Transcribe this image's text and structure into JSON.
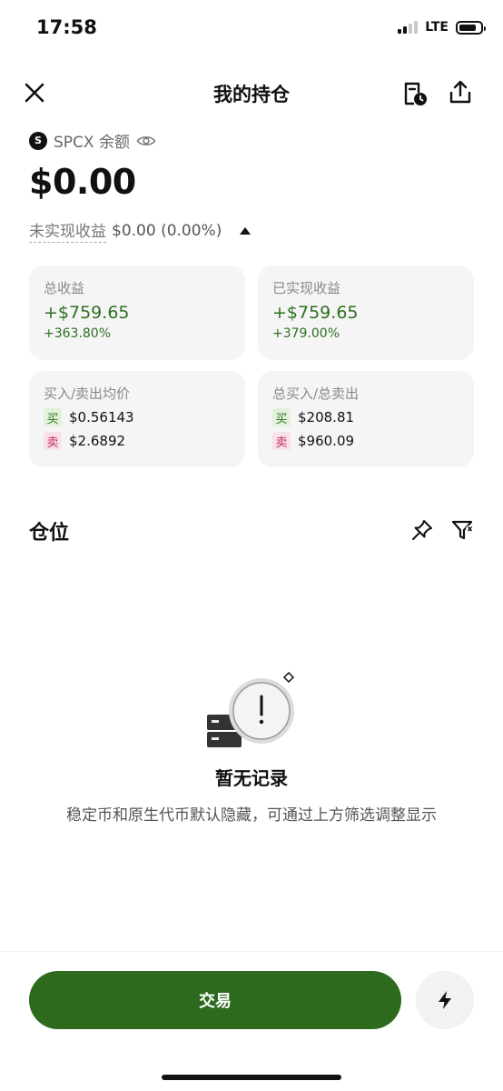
{
  "status_bar": {
    "time": "17:58",
    "network": "LTE"
  },
  "nav": {
    "title": "我的持仓",
    "close_icon": "close-icon",
    "history_icon": "order-history-icon",
    "share_icon": "share-icon"
  },
  "asset": {
    "coin_symbol": "S",
    "label": "SPCX 余额",
    "eye_icon": "eye-icon"
  },
  "balance": "$0.00",
  "unrealized": {
    "label": "未实现收益",
    "value": "$0.00 (0.00%)"
  },
  "cards": {
    "total_profit": {
      "label": "总收益",
      "value": "+$759.65",
      "percent": "+363.80%"
    },
    "realized_profit": {
      "label": "已实现收益",
      "value": "+$759.65",
      "percent": "+379.00%"
    },
    "avg_price": {
      "label": "买入/卖出均价",
      "buy_tag": "买",
      "buy_value": "$0.56143",
      "sell_tag": "卖",
      "sell_value": "$2.6892"
    },
    "total_volume": {
      "label": "总买入/总卖出",
      "buy_tag": "买",
      "buy_value": "$208.81",
      "sell_tag": "卖",
      "sell_value": "$960.09"
    }
  },
  "positions": {
    "title": "仓位",
    "pin_icon": "pin-icon",
    "filter_icon": "filter-icon"
  },
  "empty": {
    "title": "暂无记录",
    "desc": "稳定币和原生代币默认隐藏，可通过上方筛选调整显示"
  },
  "actions": {
    "trade_label": "交易",
    "flash_icon": "lightning-icon"
  },
  "colors": {
    "accent_green": "#2d6a1e",
    "profit_green": "#2e6f1f",
    "sell_pink": "#c2305e"
  }
}
